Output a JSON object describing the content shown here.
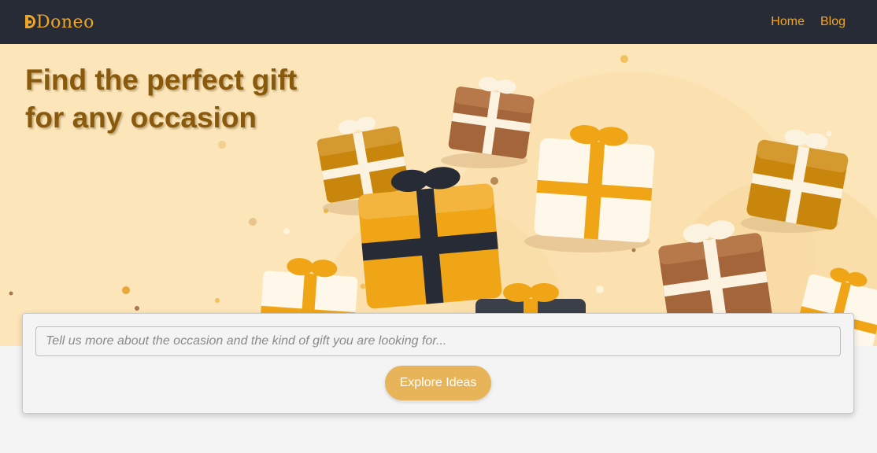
{
  "nav": {
    "brand": "Doneo",
    "links": [
      "Home",
      "Blog"
    ]
  },
  "hero": {
    "headline_line1": "Find the perfect gift",
    "headline_line2": "for any occasion"
  },
  "search": {
    "placeholder": "Tell us more about the occasion and the kind of gift you are looking for...",
    "button_label": "Explore Ideas"
  },
  "colors": {
    "nav_bg": "#262b36",
    "brand_accent": "#f0a623",
    "hero_bg": "#fce5b8",
    "headline": "#8a5a0c",
    "button_bg": "#e8b45a"
  },
  "icons": [
    "doneo-logo-icon",
    "gift-box-icon"
  ]
}
